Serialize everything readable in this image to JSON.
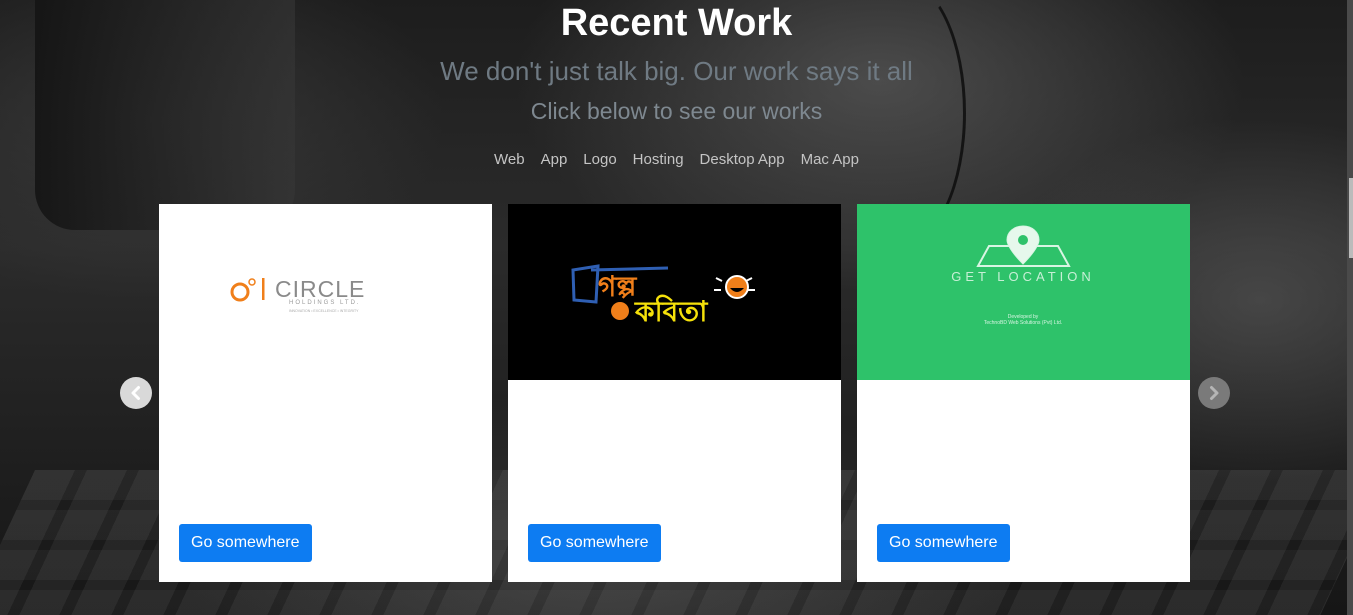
{
  "section": {
    "title": "Recent Work",
    "subtitle": "We don't just talk big. Our work says it all",
    "cta": "Click below to see our works"
  },
  "filters": [
    "Web",
    "App",
    "Logo",
    "Hosting",
    "Desktop App",
    "Mac App"
  ],
  "cards": [
    {
      "logo": {
        "mark": "O°|",
        "name": "CIRCLE",
        "sub": "HOLDINGS LTD.",
        "tagline": "INNOVATION • EXCELLENCE • INTEGRITY"
      },
      "button": "Go somewhere"
    },
    {
      "logo": {
        "line1": "গল্প",
        "line2": "কবিতা"
      },
      "button": "Go somewhere"
    },
    {
      "logo": {
        "title": "GET LOCATION",
        "small1": "Developed by",
        "small2": "TechnoBD Web Solutions (Pvt) Ltd."
      },
      "button": "Go somewhere"
    }
  ],
  "colors": {
    "button": "#0d7cf2",
    "card2_bg": "#000000",
    "card3_bg": "#2ec26a",
    "circle_orange": "#f07f1a"
  },
  "icons": {
    "prev": "chevron-left-icon",
    "next": "chevron-right-icon"
  }
}
